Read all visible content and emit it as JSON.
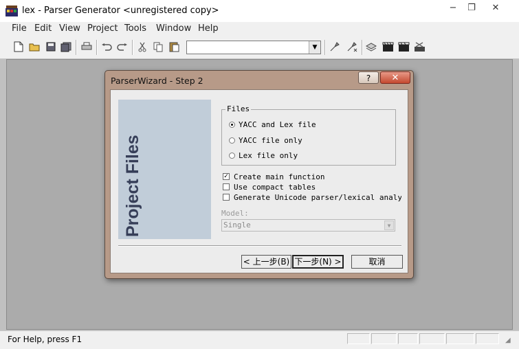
{
  "app": {
    "title": "lex - Parser Generator <unregistered copy>",
    "icon": "lex-app-icon"
  },
  "window_controls": {
    "minimize": "−",
    "restore": "❐",
    "close": "✕"
  },
  "menu": [
    "File",
    "Edit",
    "View",
    "Project",
    "Tools",
    "Window",
    "Help"
  ],
  "toolbar": {
    "buttons": [
      "new-file-icon",
      "open-folder-icon",
      "save-icon",
      "save-all-icon",
      "print-icon",
      "undo-icon",
      "redo-icon",
      "cut-icon",
      "copy-icon",
      "paste-icon",
      "build-icon",
      "rebuild-icon",
      "compile-icon",
      "run-icon",
      "clapper-icon",
      "stop-icon"
    ],
    "combo_value": ""
  },
  "status": {
    "text": "For Help, press F1"
  },
  "dialog": {
    "title": "ParserWizard - Step 2",
    "help_label": "?",
    "close_label": "✕",
    "side_title": "Project Files",
    "files_group_label": "Files",
    "radio_options": [
      {
        "label": "YACC and Lex file",
        "selected": true
      },
      {
        "label": "YACC file only",
        "selected": false
      },
      {
        "label": "Lex file only",
        "selected": false
      }
    ],
    "checkboxes": [
      {
        "label": "Create main function",
        "checked": true
      },
      {
        "label": "Use compact tables",
        "checked": false
      },
      {
        "label": "Generate Unicode parser/lexical analyser",
        "checked": false
      }
    ],
    "model_label": "Model:",
    "model_value": "Single",
    "back_button": "< 上一步(B)",
    "next_button": "下一步(N) >",
    "cancel_button": "取消"
  },
  "colors": {
    "dialog_frame": "#b79a88",
    "side_panel": "#c1cdd9",
    "side_text": "#363e58",
    "workspace": "#ababab",
    "close_button": "#c44a30"
  }
}
